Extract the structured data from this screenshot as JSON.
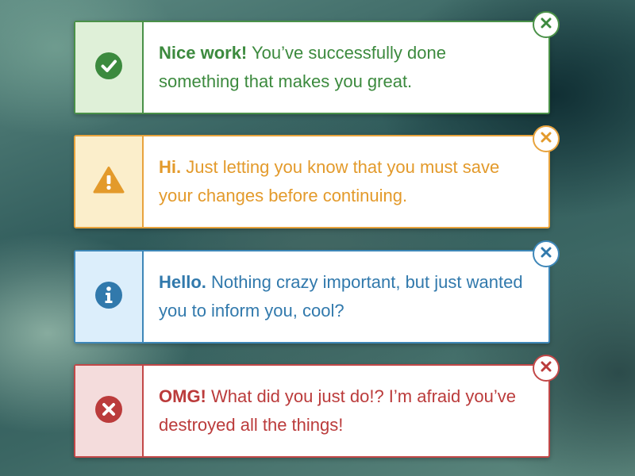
{
  "alerts": [
    {
      "type": "success",
      "icon": "check-circle-icon",
      "color": "#3c8a3e",
      "title": "Nice work!",
      "message": " You’ve successfully done something that makes you great."
    },
    {
      "type": "warning",
      "icon": "warning-triangle-icon",
      "color": "#e39a2b",
      "title": "Hi.",
      "message": " Just letting you know that you must save your changes before continuing."
    },
    {
      "type": "info",
      "icon": "info-circle-icon",
      "color": "#3179ac",
      "title": "Hello.",
      "message": " Nothing crazy important, but just wanted you to inform you, cool?"
    },
    {
      "type": "danger",
      "icon": "error-circle-icon",
      "color": "#bb3b3b",
      "title": "OMG!",
      "message": " What did you just do!? I’m afraid you’ve destroyed all the things!"
    }
  ]
}
